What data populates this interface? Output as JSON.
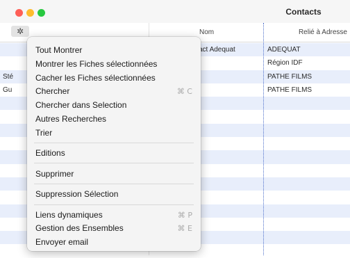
{
  "window": {
    "title": "Contacts"
  },
  "toolbar": {
    "gear_glyph": "✲"
  },
  "table": {
    "headers": {
      "nom": "Nom",
      "relie": "Relié à Adresse"
    },
    "rows": [
      {
        "left": "",
        "nom": "act Adequat",
        "adresse": "ADEQUAT"
      },
      {
        "left": "",
        "nom": "",
        "adresse": "Région IDF"
      },
      {
        "left": "Sté",
        "nom": "",
        "adresse": "PATHE FILMS"
      },
      {
        "left": "Gu",
        "nom": "",
        "adresse": "PATHE FILMS"
      }
    ]
  },
  "menu": {
    "items": [
      {
        "label": "Tout Montrer",
        "shortcut": ""
      },
      {
        "label": "Montrer les Fiches sélectionnées",
        "shortcut": ""
      },
      {
        "label": "Cacher les Fiches sélectionnées",
        "shortcut": ""
      },
      {
        "label": "Chercher",
        "shortcut": "⌘ C"
      },
      {
        "label": "Chercher dans Selection",
        "shortcut": ""
      },
      {
        "label": "Autres Recherches",
        "shortcut": ""
      },
      {
        "label": "Trier",
        "shortcut": ""
      },
      {
        "label": "Editions",
        "shortcut": ""
      },
      {
        "label": "Supprimer",
        "shortcut": ""
      },
      {
        "label": "Suppression Sélection",
        "shortcut": ""
      },
      {
        "label": "Liens dynamiques",
        "shortcut": "⌘ P"
      },
      {
        "label": "Gestion des Ensembles",
        "shortcut": "⌘ E"
      },
      {
        "label": "Envoyer email",
        "shortcut": ""
      }
    ]
  }
}
